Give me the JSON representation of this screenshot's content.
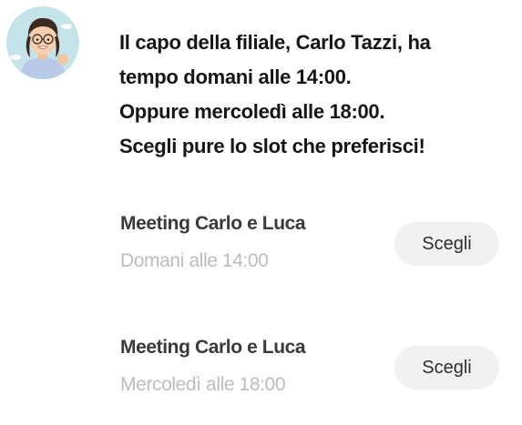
{
  "avatar": {
    "icon": "user-avatar-icon",
    "background_color": "#c4e4e9"
  },
  "message": {
    "lines": [
      "Il capo della filiale, Carlo Tazzi, ha",
      "tempo domani alle 14:00.",
      "Oppure mercoledì alle 18:00.",
      "Scegli pure lo slot che preferisci!"
    ]
  },
  "slots": [
    {
      "title": "Meeting Carlo e Luca",
      "time": "Domani alle 14:00",
      "button_label": "Scegli"
    },
    {
      "title": "Meeting Carlo e Luca",
      "time": "Mercoledì alle 18:00",
      "button_label": "Scegli"
    }
  ],
  "colors": {
    "text_primary": "#161616",
    "text_secondary": "#bcbcc2",
    "button_background": "#f1f1f3"
  }
}
